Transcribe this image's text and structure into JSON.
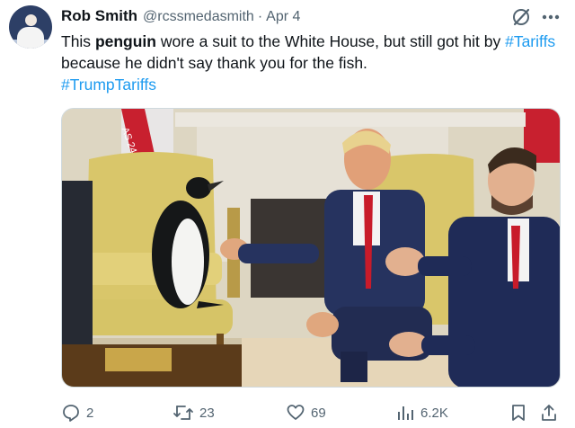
{
  "tweet": {
    "author_name": "Rob Smith",
    "handle": "@rcssmedasmith",
    "separator": "·",
    "date": "Apr 4",
    "text_parts": {
      "p1": "This ",
      "bold": "penguin",
      "p2": " wore a suit to the White House, but still got hit by ",
      "tag1": "#Tariffs",
      "p3": " because he didn't say thank you for the fish.",
      "tag2": "#TrumpTariffs"
    },
    "image_flag_text": "AS 24"
  },
  "actions": {
    "replies": "2",
    "reposts": "23",
    "likes": "69",
    "views": "6.2K"
  },
  "icons": {
    "avatar": "avatar",
    "grok": "grok-icon",
    "more": "more-icon",
    "reply": "reply-icon",
    "repost": "repost-icon",
    "like": "heart-icon",
    "views": "views-icon",
    "bookmark": "bookmark-icon",
    "share": "share-icon"
  },
  "colors": {
    "link": "#1d9bf0",
    "muted": "#536471",
    "text": "#0f1419"
  }
}
